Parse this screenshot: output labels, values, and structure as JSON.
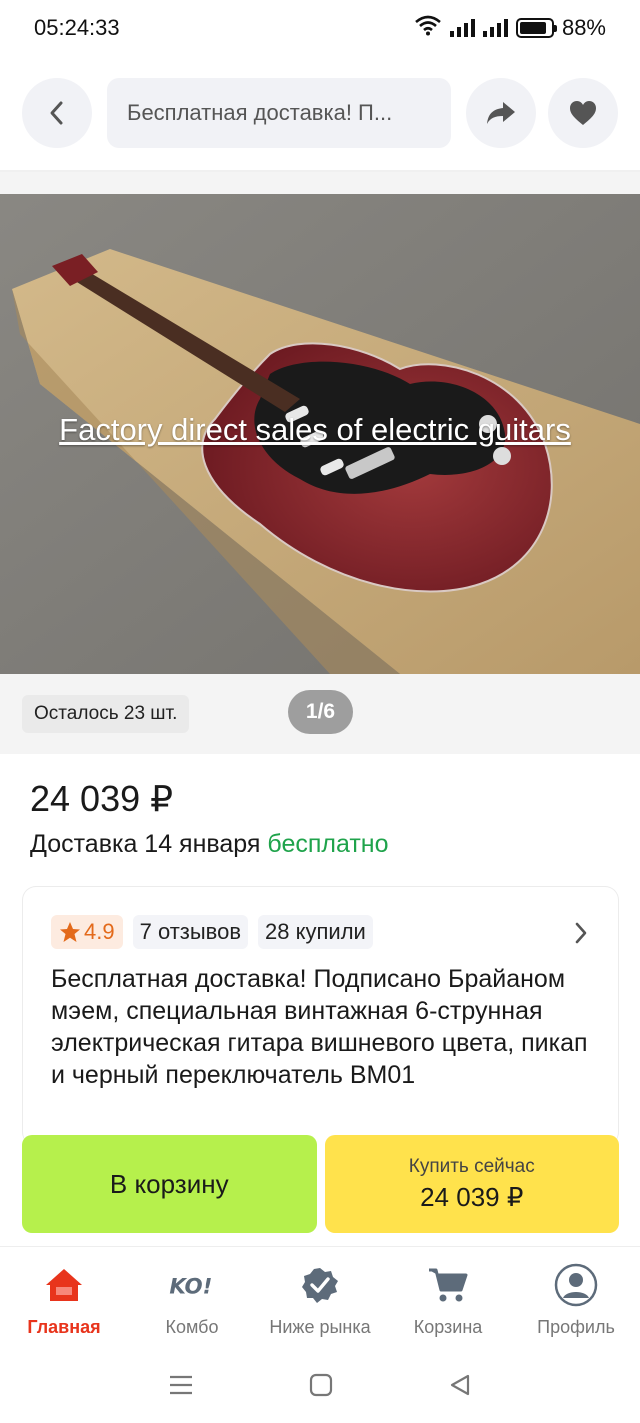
{
  "status_bar": {
    "time": "05:24:33",
    "battery": "88%",
    "battery_level": 0.88
  },
  "nav": {
    "search_text": "Бесплатная доставка! П..."
  },
  "gallery": {
    "caption": "Factory direct sales of electric guitars",
    "stock": "Осталось 23 шт.",
    "page_counter": "1/6"
  },
  "product": {
    "price": "24 039 ₽",
    "delivery_prefix": "Доставка 14 января",
    "delivery_free": "бесплатно",
    "rating": "4.9",
    "reviews": "7 отзывов",
    "bought": "28 купили",
    "title": "Бесплатная доставка! Подписано Брайаном мэем, специальная винтажная 6-струнная электрическая гитара вишневого цвета, пикап и черный переключатель BM01"
  },
  "actions": {
    "cart_label": "В корзину",
    "buy_label": "Купить сейчас",
    "buy_price": "24 039 ₽"
  },
  "tabs": [
    {
      "label": "Главная",
      "icon": "home-icon",
      "active": true
    },
    {
      "label": "Комбо",
      "icon": "ko-logo-icon",
      "active": false
    },
    {
      "label": "Ниже рынка",
      "icon": "verified-badge-icon",
      "active": false
    },
    {
      "label": "Корзина",
      "icon": "cart-icon",
      "active": false
    },
    {
      "label": "Профиль",
      "icon": "profile-icon",
      "active": false
    }
  ],
  "colors": {
    "accent": "#e8341c",
    "free": "#1fa34b",
    "cart_btn": "#b6f04c",
    "buy_btn": "#ffe24c",
    "rating": "#e36a1b"
  }
}
